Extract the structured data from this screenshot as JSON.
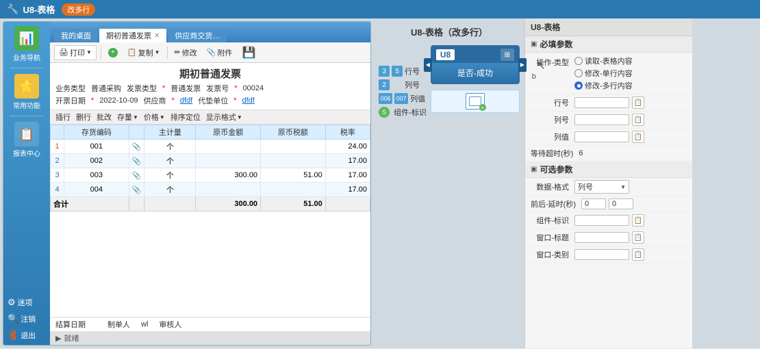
{
  "topbar": {
    "title": "U8-表格",
    "badge": "改多行"
  },
  "erp": {
    "tabs": [
      {
        "label": "我的桌面",
        "active": false
      },
      {
        "label": "期初普通发票",
        "active": true
      },
      {
        "label": "供应商交货…",
        "active": false
      }
    ],
    "toolbar": {
      "print": "打印",
      "copy": "复制",
      "modify": "修改",
      "attachment": "附件",
      "save_icon": "💾"
    },
    "page_title": "期初普通发票",
    "form": {
      "row1": [
        {
          "label": "业务类型",
          "value": "普通采购"
        },
        {
          "label": "发票类型",
          "value": "普通发票",
          "required": true
        },
        {
          "label": "发票号",
          "value": "00024",
          "required": true
        }
      ],
      "row2": [
        {
          "label": "开票日期",
          "value": "2022-10-09",
          "required": true
        },
        {
          "label": "供应商",
          "value": "dfdf",
          "required": true
        },
        {
          "label": "代垫单位",
          "value": "dfdf",
          "required": true
        }
      ]
    },
    "table_toolbar": [
      {
        "label": "插行"
      },
      {
        "label": "删行"
      },
      {
        "label": "批改"
      },
      {
        "label": "存量"
      },
      {
        "label": "价格"
      },
      {
        "label": "排序定位"
      },
      {
        "label": "显示格式"
      }
    ],
    "table": {
      "headers": [
        "插行",
        "删行",
        "批改",
        "存量",
        "价格",
        "排序定位",
        "显示格式"
      ],
      "col_headers": [
        "存货编码",
        "主计量",
        "原币金额",
        "原币税额",
        "税率"
      ],
      "rows": [
        {
          "num": "1",
          "code": "001",
          "unit": "个",
          "amount": "",
          "tax": "",
          "rate": "24.00"
        },
        {
          "num": "2",
          "code": "002",
          "unit": "个",
          "amount": "",
          "tax": "",
          "rate": "17.00"
        },
        {
          "num": "3",
          "code": "003",
          "unit": "个",
          "amount": "300.00",
          "tax": "51.00",
          "rate": "17.00"
        },
        {
          "num": "4",
          "code": "004",
          "unit": "个",
          "amount": "",
          "tax": "",
          "rate": "17.00"
        }
      ],
      "sum": {
        "label": "合计",
        "amount": "300.00",
        "tax": "51.00"
      }
    },
    "footer": {
      "settle_date_label": "结算日期",
      "settle_date": "",
      "creator_label": "制单人",
      "creator": "wl",
      "reviewer_label": "审核人",
      "reviewer": ""
    },
    "status": "就绪"
  },
  "sidebar": {
    "items": [
      {
        "icon": "📊",
        "label": "业务导航",
        "icon_type": "green"
      },
      {
        "icon": "⭐",
        "label": "常用功能",
        "icon_type": "yellow"
      },
      {
        "icon": "📋",
        "label": "报表中心",
        "icon_type": "blue"
      }
    ],
    "bottom_items": [
      {
        "icon": "⚙",
        "label": "迷项"
      },
      {
        "icon": "🔍",
        "label": "注销"
      },
      {
        "icon": "🚪",
        "label": "退出"
      }
    ]
  },
  "flow": {
    "title": "U8-表格（改多行）",
    "node": {
      "u8_label": "U8",
      "title": "是否-成功",
      "b_label": "b"
    },
    "connectors": [
      {
        "left": "3",
        "right": "5",
        "label": "行号",
        "left_type": "num",
        "right_type": "num"
      },
      {
        "left": "2",
        "label": "列号",
        "left_type": "num"
      },
      {
        "left": "006",
        "right": "007",
        "label": "列值",
        "left_type": "num",
        "right_type": "num"
      },
      {
        "left": "S",
        "label": "组件-标识",
        "left_type": "letter"
      }
    ],
    "sub_node_label": ""
  },
  "right_panel": {
    "title": "U8-表格",
    "required_section": "必填参数",
    "optional_section": "可选参数",
    "params": {
      "operation_type_label": "操作-类型",
      "operation_options": [
        {
          "label": "读取-表格内容",
          "selected": false
        },
        {
          "label": "修改-单行内容",
          "selected": false
        },
        {
          "label": "修改-多行内容",
          "selected": true
        }
      ],
      "row_label": "行号",
      "col_label": "列号",
      "value_label": "列值",
      "wait_label": "等待超时(秒)",
      "wait_value": "6",
      "data_format_label": "数据-格式",
      "data_format_value": "列号",
      "delay_label": "前后-延时(秒)",
      "delay_before": "0",
      "delay_after": "0",
      "component_id_label": "组件-标识",
      "window_title_label": "窗口-标题",
      "window_type_label": "窗口-类别"
    }
  }
}
